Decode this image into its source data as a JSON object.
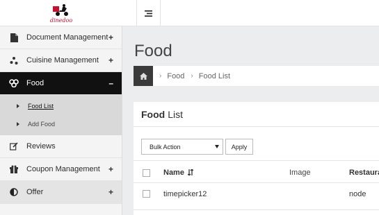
{
  "brand": {
    "name": "dinedoo"
  },
  "sidebar": {
    "items": [
      {
        "label": "Document Management",
        "icon": "file-icon",
        "expander": "+"
      },
      {
        "label": "Cuisine Management",
        "icon": "cuisine-icon",
        "expander": "+"
      },
      {
        "label": "Food",
        "icon": "food-icon",
        "expander": "–",
        "active": true,
        "children": [
          {
            "label": "Food List",
            "current": true
          },
          {
            "label": "Add Food"
          }
        ]
      },
      {
        "label": "Reviews",
        "icon": "edit-icon"
      },
      {
        "label": "Coupon Management",
        "icon": "gift-icon",
        "expander": "+"
      },
      {
        "label": "Offer",
        "icon": "adjust-icon",
        "expander": "+"
      }
    ]
  },
  "main": {
    "title": "Food",
    "breadcrumb": [
      "Food",
      "Food List"
    ],
    "panel": {
      "title_bold": "Food",
      "title_rest": "List",
      "bulk_action": "Bulk Action",
      "apply_label": "Apply",
      "columns": [
        "Name",
        "Image",
        "Restaura"
      ],
      "rows": [
        {
          "name": "timepicker12",
          "image": "",
          "restaurant": "node"
        }
      ]
    }
  },
  "colors": {
    "brand_red": "#c8102e",
    "active_bg": "#111111",
    "sidebar_bg": "#f4f4f4"
  }
}
